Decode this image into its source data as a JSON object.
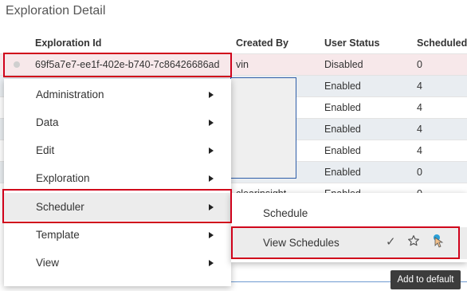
{
  "page": {
    "title": "Exploration Detail"
  },
  "table": {
    "headers": {
      "id": "Exploration Id",
      "created_by": "Created By",
      "user_status": "User Status",
      "scheduled": "Scheduled"
    },
    "rows": [
      {
        "id": "69f5a7e7-ee1f-402e-b740-7c86426686ad",
        "created_by": "vin",
        "status": "Disabled",
        "scheduled": "0"
      },
      {
        "id": "",
        "created_by": "",
        "status": "Enabled",
        "scheduled": "4"
      },
      {
        "id": "",
        "created_by": "",
        "status": "Enabled",
        "scheduled": "4"
      },
      {
        "id": "",
        "created_by": "",
        "status": "Enabled",
        "scheduled": "4"
      },
      {
        "id": "",
        "created_by": "",
        "status": "Enabled",
        "scheduled": "4"
      },
      {
        "id": "",
        "created_by": "",
        "status": "Enabled",
        "scheduled": "0"
      },
      {
        "id": "",
        "created_by": "clearinsight",
        "status": "Enabled",
        "scheduled": "0"
      }
    ]
  },
  "context_menu": {
    "items": [
      {
        "label": "Administration"
      },
      {
        "label": "Data"
      },
      {
        "label": "Edit"
      },
      {
        "label": "Exploration"
      },
      {
        "label": "Scheduler"
      },
      {
        "label": "Template"
      },
      {
        "label": "View"
      }
    ]
  },
  "submenu": {
    "items": [
      {
        "label": "Schedule"
      },
      {
        "label": "View Schedules"
      }
    ]
  },
  "tooltip": {
    "text": "Add to default"
  },
  "colors": {
    "highlight": "#d0021b",
    "selected_row": "#f7e8ea",
    "alt_row": "#e9edf1",
    "pin_accent": "#2a9fd6"
  }
}
